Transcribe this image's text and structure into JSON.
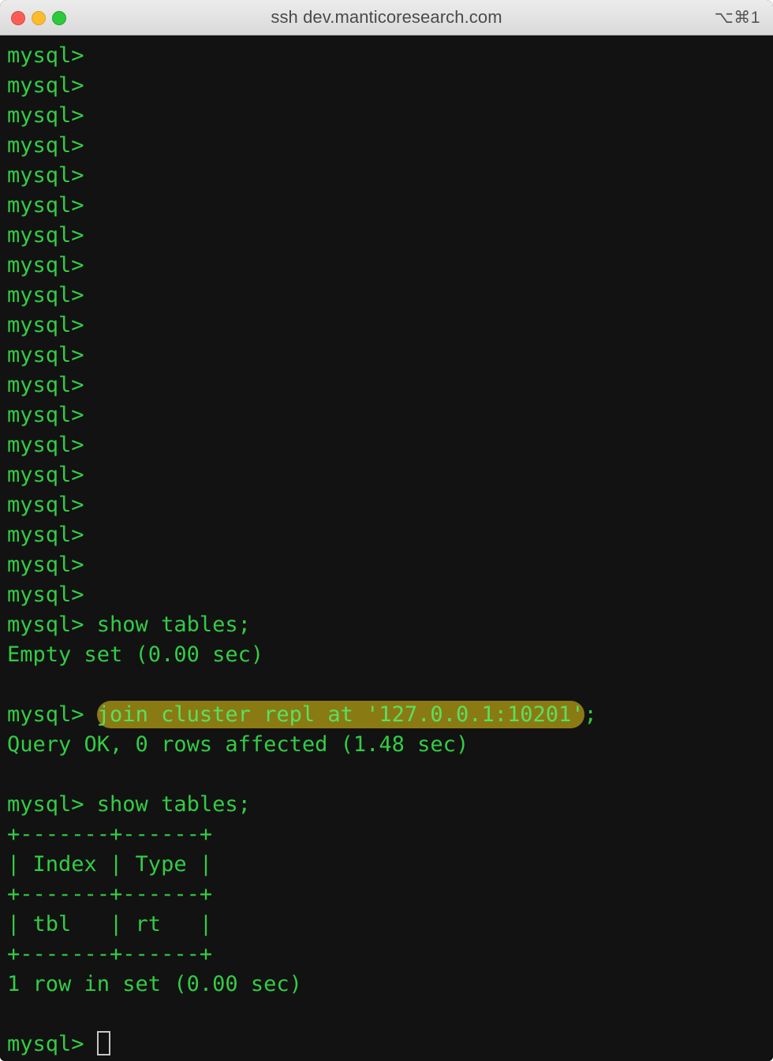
{
  "window": {
    "title": "ssh dev.manticoresearch.com",
    "shortcut": "⌥⌘1",
    "traffic_lights": [
      {
        "name": "close",
        "color": "#fc5d57"
      },
      {
        "name": "minimize",
        "color": "#fdbc2e"
      },
      {
        "name": "zoom",
        "color": "#2dc93c"
      }
    ]
  },
  "theme": {
    "background": "#121212",
    "foreground": "#33cc44",
    "highlight_bg": "#8a7a14",
    "highlight_fg": "#5ae05f",
    "cursor": "#c8c8c8",
    "titlebar_bg": "#e4e4e4",
    "titlebar_fg": "#4b4b4b"
  },
  "terminal": {
    "prompt": "mysql> ",
    "empty_prompt_count": 19,
    "empty_prompt_line": "mysql> ",
    "lines": [
      {
        "kind": "prompt",
        "text": "mysql> show tables;"
      },
      {
        "kind": "output",
        "text": "Empty set (0.00 sec)"
      },
      {
        "kind": "blank",
        "text": " "
      },
      {
        "kind": "prompt-highlight",
        "prefix": "mysql> ",
        "highlight": "join cluster repl at '127.0.0.1:10201'",
        "suffix": ";"
      },
      {
        "kind": "output",
        "text": "Query OK, 0 rows affected (1.48 sec)"
      },
      {
        "kind": "blank",
        "text": " "
      },
      {
        "kind": "prompt",
        "text": "mysql> show tables;"
      },
      {
        "kind": "output",
        "text": "+-------+------+"
      },
      {
        "kind": "output",
        "text": "| Index | Type |"
      },
      {
        "kind": "output",
        "text": "+-------+------+"
      },
      {
        "kind": "output",
        "text": "| tbl   | rt   |"
      },
      {
        "kind": "output",
        "text": "+-------+------+"
      },
      {
        "kind": "output",
        "text": "1 row in set (0.00 sec)"
      },
      {
        "kind": "blank",
        "text": " "
      },
      {
        "kind": "cursor-prompt",
        "text": "mysql> "
      }
    ],
    "command_history": [
      "show tables;",
      "join cluster repl at '127.0.0.1:10201';",
      "show tables;"
    ],
    "table": {
      "headers": [
        "Index",
        "Type"
      ],
      "rows": [
        [
          "tbl",
          "rt"
        ]
      ],
      "row_count_text": "1 row in set (0.00 sec)"
    }
  }
}
